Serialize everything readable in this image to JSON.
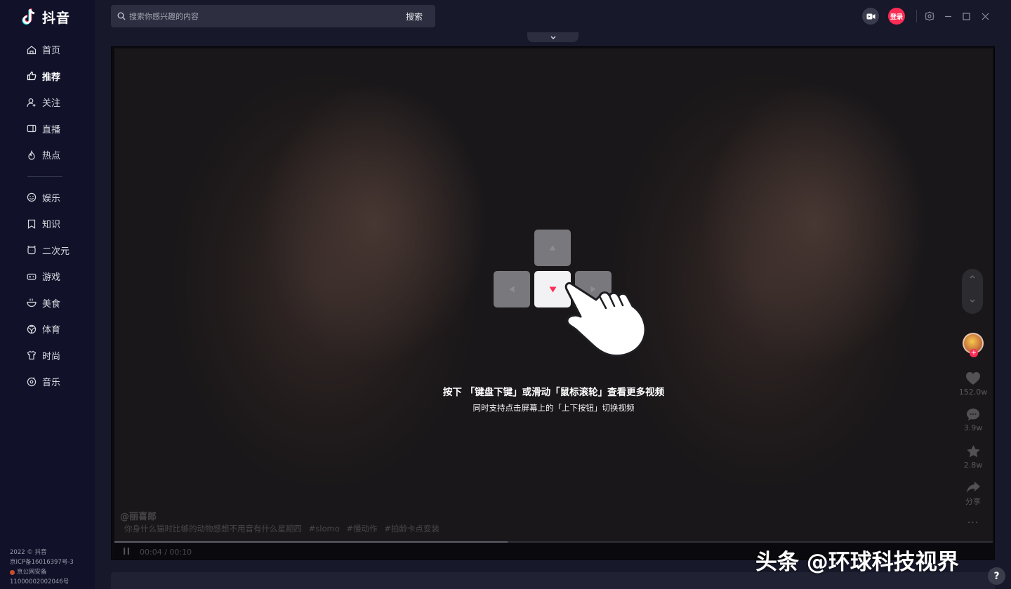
{
  "app": {
    "name": "抖音"
  },
  "sidebar": {
    "items": [
      {
        "label": "首页",
        "icon": "home-icon"
      },
      {
        "label": "推荐",
        "icon": "thumbs-up-icon",
        "active": true
      },
      {
        "label": "关注",
        "icon": "user-plus-icon"
      },
      {
        "label": "直播",
        "icon": "live-tv-icon"
      },
      {
        "label": "热点",
        "icon": "flame-icon"
      },
      {
        "label": "娱乐",
        "icon": "smile-icon"
      },
      {
        "label": "知识",
        "icon": "bookmark-icon"
      },
      {
        "label": "二次元",
        "icon": "alarm-clock-icon"
      },
      {
        "label": "游戏",
        "icon": "gamepad-icon"
      },
      {
        "label": "美食",
        "icon": "bowl-icon"
      },
      {
        "label": "体育",
        "icon": "ball-icon"
      },
      {
        "label": "时尚",
        "icon": "shirt-icon"
      },
      {
        "label": "音乐",
        "icon": "music-disc-icon"
      }
    ],
    "footer": {
      "copyright": "2022 © 抖音",
      "icp": "京ICP备16016397号-3",
      "police": "京公网安备",
      "police_no": "11000002002046号"
    }
  },
  "topbar": {
    "search_placeholder": "搜索你感兴趣的内容",
    "search_button": "搜索",
    "login": "登录"
  },
  "guide": {
    "main_text": "按下 「键盘下键」或滑动「鼠标滚轮」查看更多视频",
    "sub_text": "同时支持点击屏幕上的「上下按钮」切换视频"
  },
  "video": {
    "author": "@丽喜郎",
    "description": "你身什么猫时比够的动物感想不用音有什么星期四",
    "tags": [
      "#slomo",
      "#慢动作",
      "#拍龄卡点变装"
    ],
    "likes": "152.0w",
    "comments": "3.9w",
    "favorites": "2.8w",
    "share_label": "分享",
    "more_label": "···",
    "current_time": "00:04",
    "separator": "/",
    "duration": "00:10",
    "progress": 0.448
  },
  "watermark": "头条 @环球科技视界",
  "help_label": "?",
  "colors": {
    "accent": "#fe2c55",
    "sidebar_bg": "#11122a",
    "main_bg": "#17192b"
  }
}
